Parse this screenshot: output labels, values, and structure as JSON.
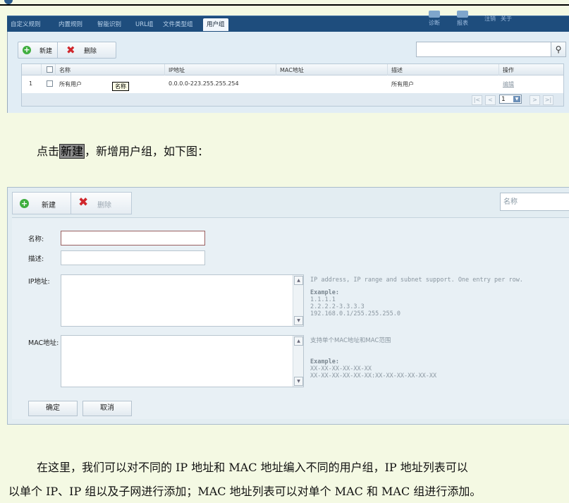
{
  "top_screenshot": {
    "nav_tabs": [
      "自定义规则",
      "内置规则",
      "智能识别",
      "URL组",
      "文件类型组",
      "用户组"
    ],
    "active_tab": "用户组",
    "nav_right": [
      "诊断",
      "报表",
      "注销",
      "关于"
    ],
    "toolbar": {
      "new_label": "新建",
      "delete_label": "删除"
    },
    "search": {
      "placeholder": ""
    },
    "table": {
      "headers": [
        "",
        "",
        "名称",
        "IP地址",
        "MAC地址",
        "描述",
        "操作"
      ],
      "rows": [
        {
          "index": "1",
          "name": "所有用户",
          "ip": "0.0.0.0-223.255.255.254",
          "mac": "",
          "desc": "所有用户",
          "action": "编辑"
        }
      ],
      "tooltip": "名称"
    },
    "pager": {
      "page": "1"
    }
  },
  "paragraph1": {
    "prefix": "点击",
    "highlight": "新建",
    "suffix": "，新增用户组，如下图："
  },
  "bottom_screenshot": {
    "toolbar": {
      "new_label": "新建",
      "delete_label": "删除"
    },
    "search": {
      "placeholder": "名称"
    },
    "form": {
      "name_label": "名称:",
      "desc_label": "描述:",
      "ip_label": "IP地址:",
      "mac_label": "MAC地址:",
      "ip_hint": "IP address, IP range and subnet support. One entry per row.",
      "ip_example_title": "Example:",
      "ip_examples": [
        "1.1.1.1",
        "2.2.2.2-3.3.3.3",
        "192.168.0.1/255.255.255.0"
      ],
      "mac_hint": "支持单个MAC地址和MAC范围",
      "mac_example_title": "Example:",
      "mac_examples": [
        "XX-XX-XX-XX-XX-XX",
        "XX-XX-XX-XX-XX-XX:XX-XX-XX-XX-XX-XX"
      ]
    },
    "buttons": {
      "ok": "确定",
      "cancel": "取消"
    }
  },
  "paragraph2": {
    "line1": "在这里，我们可以对不同的 IP 地址和 MAC 地址编入不同的用户组，IP 地址列表可以",
    "line2": "以单个 IP、IP 组以及子网进行添加；MAC 地址列表可以对单个 MAC 和 MAC 组进行添加。"
  },
  "colors": {
    "nav_bg": "#1e4d7d",
    "panel_bg": "#e1edf5",
    "page_bg": "#f4f9e3",
    "add_green": "#3fae3f",
    "delete_red": "#d0272c"
  }
}
